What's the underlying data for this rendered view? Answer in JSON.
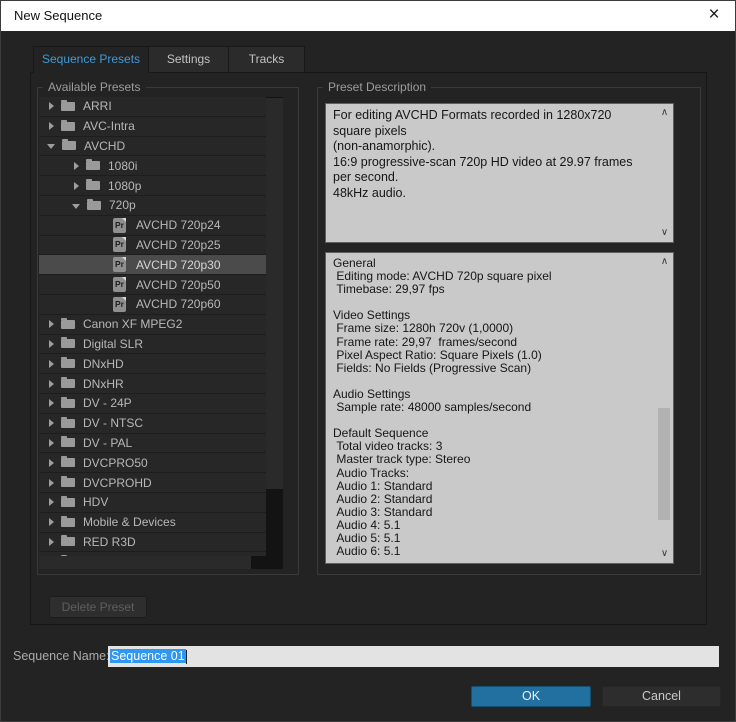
{
  "window": {
    "title": "New Sequence",
    "close_icon": "×"
  },
  "tabs": [
    {
      "label": "Sequence Presets",
      "active": true
    },
    {
      "label": "Settings",
      "active": false
    },
    {
      "label": "Tracks",
      "active": false
    }
  ],
  "icons": {
    "preset_icon_text": "Pr",
    "scroll_up": "∧",
    "scroll_down": "∨"
  },
  "presets_panel": {
    "group_label": "Available Presets",
    "tree": [
      {
        "label": "ARRI",
        "type": "folder",
        "level": 0,
        "expanded": false
      },
      {
        "label": "AVC-Intra",
        "type": "folder",
        "level": 0,
        "expanded": false
      },
      {
        "label": "AVCHD",
        "type": "folder",
        "level": 0,
        "expanded": true
      },
      {
        "label": "1080i",
        "type": "folder",
        "level": 1,
        "expanded": false
      },
      {
        "label": "1080p",
        "type": "folder",
        "level": 1,
        "expanded": false
      },
      {
        "label": "720p",
        "type": "folder",
        "level": 1,
        "expanded": true
      },
      {
        "label": "AVCHD 720p24",
        "type": "preset",
        "level": 2,
        "selected": false
      },
      {
        "label": "AVCHD 720p25",
        "type": "preset",
        "level": 2,
        "selected": false
      },
      {
        "label": "AVCHD 720p30",
        "type": "preset",
        "level": 2,
        "selected": true
      },
      {
        "label": "AVCHD 720p50",
        "type": "preset",
        "level": 2,
        "selected": false
      },
      {
        "label": "AVCHD 720p60",
        "type": "preset",
        "level": 2,
        "selected": false
      },
      {
        "label": "Canon XF MPEG2",
        "type": "folder",
        "level": 0,
        "expanded": false
      },
      {
        "label": "Digital SLR",
        "type": "folder",
        "level": 0,
        "expanded": false
      },
      {
        "label": "DNxHD",
        "type": "folder",
        "level": 0,
        "expanded": false
      },
      {
        "label": "DNxHR",
        "type": "folder",
        "level": 0,
        "expanded": false
      },
      {
        "label": "DV - 24P",
        "type": "folder",
        "level": 0,
        "expanded": false
      },
      {
        "label": "DV - NTSC",
        "type": "folder",
        "level": 0,
        "expanded": false
      },
      {
        "label": "DV - PAL",
        "type": "folder",
        "level": 0,
        "expanded": false
      },
      {
        "label": "DVCPRO50",
        "type": "folder",
        "level": 0,
        "expanded": false
      },
      {
        "label": "DVCPROHD",
        "type": "folder",
        "level": 0,
        "expanded": false
      },
      {
        "label": "HDV",
        "type": "folder",
        "level": 0,
        "expanded": false
      },
      {
        "label": "Mobile & Devices",
        "type": "folder",
        "level": 0,
        "expanded": false
      },
      {
        "label": "RED R3D",
        "type": "folder",
        "level": 0,
        "expanded": false
      },
      {
        "label": "XDCAM EX",
        "type": "folder",
        "level": 0,
        "expanded": false
      }
    ],
    "delete_button_label": "Delete Preset"
  },
  "description_panel": {
    "group_label": "Preset Description",
    "description_lines": [
      "For editing AVCHD Formats recorded in 1280x720 square pixels",
      "(non-anamorphic).",
      "16:9 progressive-scan 720p HD video at 29.97 frames per second.",
      "48kHz audio."
    ],
    "details_lines": [
      "General",
      " Editing mode: AVCHD 720p square pixel",
      " Timebase: 29,97 fps",
      "",
      "Video Settings",
      " Frame size: 1280h 720v (1,0000)",
      " Frame rate: 29,97  frames/second",
      " Pixel Aspect Ratio: Square Pixels (1.0)",
      " Fields: No Fields (Progressive Scan)",
      "",
      "Audio Settings",
      " Sample rate: 48000 samples/second",
      "",
      "Default Sequence",
      " Total video tracks: 3",
      " Master track type: Stereo",
      " Audio Tracks:",
      " Audio 1: Standard",
      " Audio 2: Standard",
      " Audio 3: Standard",
      " Audio 4: 5.1",
      " Audio 5: 5.1",
      " Audio 6: 5.1"
    ]
  },
  "footer": {
    "sequence_name_label": "Sequence Name:",
    "sequence_name_value": "Sequence 01",
    "ok_label": "OK",
    "cancel_label": "Cancel"
  },
  "colors": {
    "dialog_background": "#232323",
    "titlebar_background": "#ffffff",
    "tab_active_text": "#3f9bd8",
    "selected_row": "#4b4b4b",
    "textbox_background": "#c9c9c9",
    "ok_button": "#21709f",
    "text_selection": "#2e96f5"
  }
}
